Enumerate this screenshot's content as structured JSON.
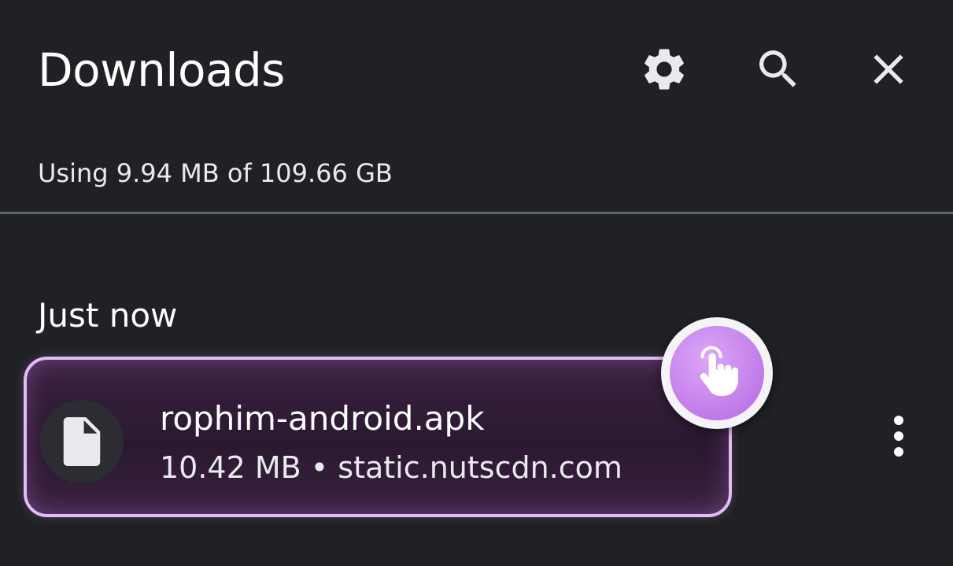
{
  "header": {
    "title": "Downloads",
    "icons": {
      "settings": "gear-icon",
      "search": "search-icon",
      "close": "close-icon"
    }
  },
  "storage": {
    "text": "Using 9.94 MB of 109.66 GB"
  },
  "sections": [
    {
      "label": "Just now",
      "items": [
        {
          "file_name": "rophim-android.apk",
          "meta": "10.42 MB • static.nutscdn.com",
          "icon": "file-icon",
          "more_icon": "more-vert-icon"
        }
      ]
    }
  ],
  "overlay": {
    "tap_indicator_icon": "hand-pointer-icon"
  },
  "colors": {
    "background": "#202124",
    "highlight_border": "#e3bdf5",
    "tap_indicator": "#c07ae8"
  }
}
